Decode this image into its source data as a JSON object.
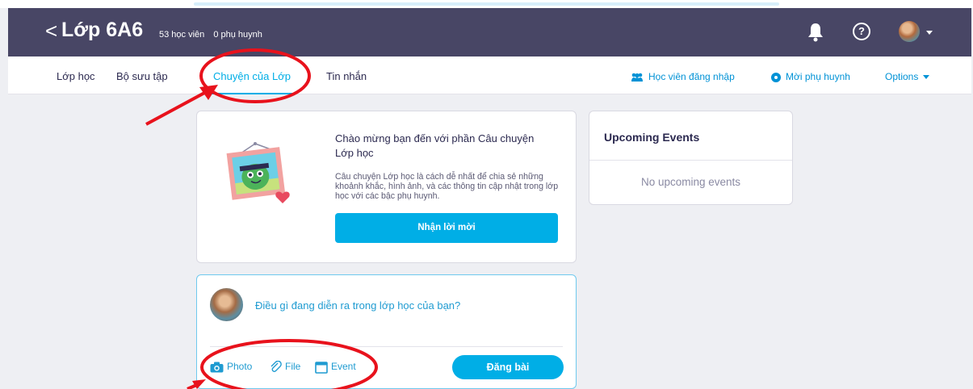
{
  "header": {
    "back_glyph": "<",
    "class_name": "Lớp 6A6",
    "student_count": "53 học viên",
    "parent_count": "0 phụ huynh",
    "icons": [
      "bell-icon",
      "help-icon",
      "user-avatar"
    ]
  },
  "tabs": [
    {
      "label": "Lớp học"
    },
    {
      "label": "Bộ sưu tập"
    },
    {
      "label": "Chuyện của Lớp",
      "active": true
    },
    {
      "label": "Tin nhắn"
    }
  ],
  "right_links": {
    "student_login": "Học viên đăng nhập",
    "invite_parents": "Mời phụ huynh",
    "options": "Options"
  },
  "welcome_card": {
    "title": "Chào mừng bạn đến với phần Câu chuyện Lớp học",
    "body": "Câu chuyện Lớp học là cách dễ nhất để chia sẻ những khoảnh khắc, hình ảnh, và các thông tin cập nhật trong lớp học với các bậc phụ huynh.",
    "button_label": "Nhận lời mời"
  },
  "events_card": {
    "title": "Upcoming Events",
    "empty_text": "No upcoming events"
  },
  "composer": {
    "placeholder": "Điều gì đang diễn ra trong lớp học của bạn?",
    "attachments": {
      "photo": "Photo",
      "file": "File",
      "event": "Event"
    },
    "post_button": "Đăng bài"
  },
  "colors": {
    "topbar": "#484665",
    "accent": "#00aee6",
    "link": "#0092d6",
    "annotation": "#e8121c"
  }
}
